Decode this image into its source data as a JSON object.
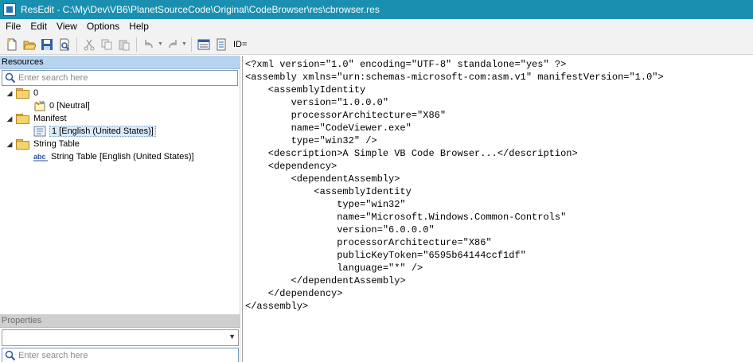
{
  "window": {
    "title": "ResEdit - C:\\My\\Dev\\VB6\\PlanetSourceCode\\Original\\CodeBrowser\\res\\cbrowser.res"
  },
  "menu": [
    "File",
    "Edit",
    "View",
    "Options",
    "Help"
  ],
  "toolbar": {
    "id_label": "ID="
  },
  "resources": {
    "header": "Resources",
    "search_placeholder": "Enter search here",
    "tree": [
      {
        "label": "0",
        "type": "folder"
      },
      {
        "label": "0 [Neutral]",
        "type": "item"
      },
      {
        "label": "Manifest",
        "type": "folder"
      },
      {
        "label": "1 [English (United States)]",
        "type": "item",
        "selected": true
      },
      {
        "label": "String Table",
        "type": "folder"
      },
      {
        "label": "String Table [English (United States)]",
        "type": "item"
      }
    ]
  },
  "properties": {
    "header": "Properties",
    "search_placeholder": "Enter search here"
  },
  "editor": {
    "lines": [
      "<?xml version=\"1.0\" encoding=\"UTF-8\" standalone=\"yes\" ?>",
      "<assembly xmlns=\"urn:schemas-microsoft-com:asm.v1\" manifestVersion=\"1.0\">",
      "    <assemblyIdentity",
      "        version=\"1.0.0.0\"",
      "        processorArchitecture=\"X86\"",
      "        name=\"CodeViewer.exe\"",
      "        type=\"win32\" />",
      "    <description>A Simple VB Code Browser...</description>",
      "    <dependency>",
      "        <dependentAssembly>",
      "            <assemblyIdentity",
      "                type=\"win32\"",
      "                name=\"Microsoft.Windows.Common-Controls\"",
      "                version=\"6.0.0.0\"",
      "                processorArchitecture=\"X86\"",
      "                publicKeyToken=\"6595b64144ccf1df\"",
      "                language=\"*\" />",
      "        </dependentAssembly>",
      "    </dependency>",
      "</assembly>"
    ]
  }
}
